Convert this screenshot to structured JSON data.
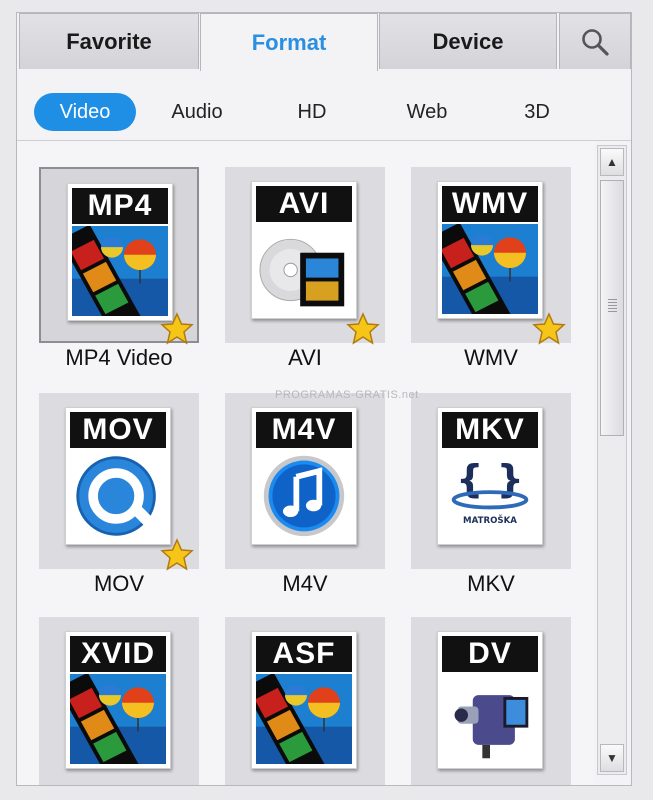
{
  "tabs": [
    {
      "label": "Favorite"
    },
    {
      "label": "Format"
    },
    {
      "label": "Device"
    }
  ],
  "subtabs": [
    {
      "label": "Video"
    },
    {
      "label": "Audio"
    },
    {
      "label": "HD"
    },
    {
      "label": "Web"
    },
    {
      "label": "3D"
    }
  ],
  "formats": [
    {
      "badge": "MP4",
      "label": "MP4 Video",
      "favorite": true,
      "art": "film"
    },
    {
      "badge": "AVI",
      "label": "AVI",
      "favorite": true,
      "art": "disc"
    },
    {
      "badge": "WMV",
      "label": "WMV",
      "favorite": true,
      "art": "film"
    },
    {
      "badge": "MOV",
      "label": "MOV",
      "favorite": true,
      "art": "quicktime"
    },
    {
      "badge": "M4V",
      "label": "M4V",
      "favorite": false,
      "art": "itunes"
    },
    {
      "badge": "MKV",
      "label": "MKV",
      "favorite": false,
      "art": "matroska"
    },
    {
      "badge": "XVID",
      "label": "",
      "favorite": false,
      "art": "film"
    },
    {
      "badge": "ASF",
      "label": "",
      "favorite": false,
      "art": "film"
    },
    {
      "badge": "DV",
      "label": "",
      "favorite": false,
      "art": "camera"
    }
  ],
  "matroska_text": "MATROŠKA",
  "watermark": "PROGRAMAS-GRATIS.net",
  "colors": {
    "accent": "#1f8fe6",
    "active_tab_text": "#2a8fe0",
    "star": "#f5c518"
  }
}
